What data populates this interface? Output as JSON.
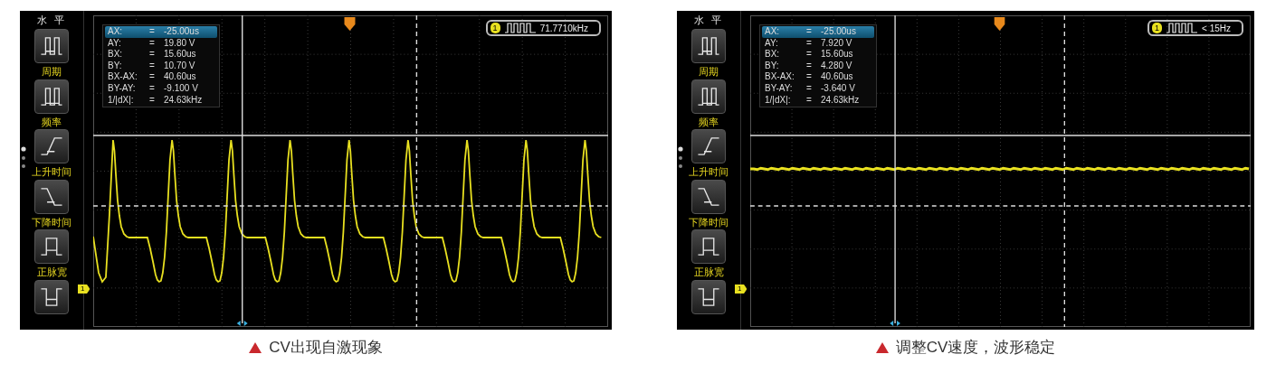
{
  "panels": [
    {
      "sidebar": {
        "title": "水 平",
        "buttons": [
          {
            "kind": "period",
            "label": "周期"
          },
          {
            "kind": "frequency",
            "label": "频率"
          },
          {
            "kind": "rise",
            "label": "上升时间"
          },
          {
            "kind": "fall",
            "label": "下降时间"
          },
          {
            "kind": "positive",
            "label": "正脉宽"
          },
          {
            "kind": "negative"
          }
        ]
      },
      "readout": [
        {
          "name": "AX:",
          "eq": "=",
          "value": "-25.00us",
          "selected": true
        },
        {
          "name": "AY:",
          "eq": "=",
          "value": "19.80 V",
          "selected": false
        },
        {
          "name": "BX:",
          "eq": "=",
          "value": "15.60us",
          "selected": false
        },
        {
          "name": "BY:",
          "eq": "=",
          "value": "10.70 V",
          "selected": false
        },
        {
          "name": "BX-AX:",
          "eq": "=",
          "value": "40.60us",
          "selected": false
        },
        {
          "name": "BY-AY:",
          "eq": "=",
          "value": "-9.100 V",
          "selected": false
        },
        {
          "name": "1/|dX|:",
          "eq": "=",
          "value": "24.63kHz",
          "selected": false
        }
      ],
      "frequency": {
        "channel": "1",
        "value": "71.7710kHz"
      },
      "channel_marker": "1",
      "waveform": {
        "kind": "oscillating"
      },
      "caption": "CV出现自激现象"
    },
    {
      "sidebar": {
        "title": "水 平",
        "buttons": [
          {
            "kind": "period",
            "label": "周期"
          },
          {
            "kind": "frequency",
            "label": "频率"
          },
          {
            "kind": "rise",
            "label": "上升时间"
          },
          {
            "kind": "fall",
            "label": "下降时间"
          },
          {
            "kind": "positive",
            "label": "正脉宽"
          },
          {
            "kind": "negative"
          }
        ]
      },
      "readout": [
        {
          "name": "AX:",
          "eq": "=",
          "value": "-25.00us",
          "selected": true
        },
        {
          "name": "AY:",
          "eq": "=",
          "value": "7.920 V",
          "selected": false
        },
        {
          "name": "BX:",
          "eq": "=",
          "value": "15.60us",
          "selected": false
        },
        {
          "name": "BY:",
          "eq": "=",
          "value": "4.280 V",
          "selected": false
        },
        {
          "name": "BX-AX:",
          "eq": "=",
          "value": "40.60us",
          "selected": false
        },
        {
          "name": "BY-AY:",
          "eq": "=",
          "value": "-3.640 V",
          "selected": false
        },
        {
          "name": "1/|dX|:",
          "eq": "=",
          "value": "24.63kHz",
          "selected": false
        }
      ],
      "frequency": {
        "channel": "1",
        "value": "< 15Hz"
      },
      "channel_marker": "1",
      "waveform": {
        "kind": "flat"
      },
      "caption": "调整CV速度，波形稳定"
    }
  ]
}
